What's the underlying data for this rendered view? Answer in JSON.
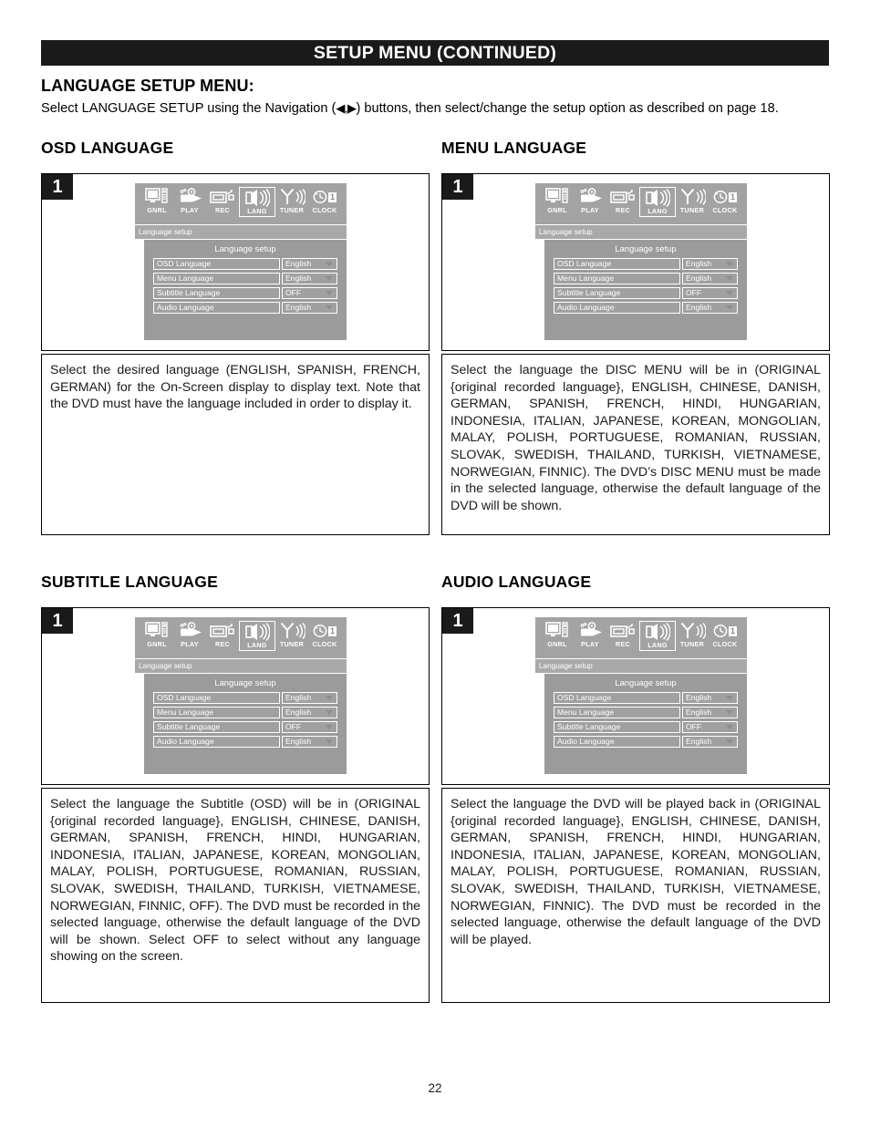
{
  "header": {
    "title": "SETUP MENU (CONTINUED)"
  },
  "intro": {
    "heading": "LANGUAGE SETUP MENU:",
    "body_before": "Select LANGUAGE SETUP using the Navigation (",
    "nav_glyphs": "◀,▶",
    "body_after": ") buttons, then select/change the setup option as described on page 18."
  },
  "sections": {
    "osd": {
      "heading": "OSD LANGUAGE",
      "step": "1",
      "description": "Select the desired language (ENGLISH, SPANISH, FRENCH, GERMAN) for the On-Screen display to display text. Note that the DVD must have the language included in order to display it."
    },
    "menu": {
      "heading": "MENU LANGUAGE",
      "step": "1",
      "description": "Select the language the DISC MENU will be in (ORIGINAL {original recorded language}, ENGLISH, CHINESE, DANISH, GERMAN, SPANISH, FRENCH, HINDI, HUNGARIAN, INDONESIA, ITALIAN, JAPANESE, KOREAN, MONGOLIAN, MALAY, POLISH, PORTUGUESE, ROMANIAN, RUSSIAN, SLOVAK, SWEDISH, THAILAND, TURKISH, VIETNAMESE, NORWEGIAN, FINNIC). The DVD’s DISC MENU must be made in the selected language, otherwise the default language of the DVD will be shown."
    },
    "subtitle": {
      "heading": "SUBTITLE LANGUAGE",
      "step": "1",
      "description": "Select the language the Subtitle (OSD) will be in (ORIGINAL {original recorded language}, ENGLISH, CHINESE, DANISH, GERMAN, SPANISH, FRENCH, HINDI, HUNGARIAN, INDONESIA, ITALIAN, JAPANESE, KOREAN, MONGOLIAN, MALAY, POLISH, PORTUGUESE, ROMANIAN, RUSSIAN, SLOVAK, SWEDISH, THAILAND, TURKISH, VIETNAMESE, NORWEGIAN, FINNIC, OFF). The DVD must be recorded in the selected language, otherwise the default language of the DVD will be shown. Select OFF to select without any language showing on the screen."
    },
    "audio": {
      "heading": "AUDIO LANGUAGE",
      "step": "1",
      "description": "Select the language the DVD will be played back in (ORIGINAL {original recorded language}, ENGLISH, CHINESE, DANISH, GERMAN, SPANISH, FRENCH, HINDI, HUNGARIAN, INDONESIA, ITALIAN, JAPANESE, KOREAN, MONGOLIAN, MALAY, POLISH, PORTUGUESE, ROMANIAN, RUSSIAN, SLOVAK, SWEDISH, THAILAND, TURKISH, VIETNAMESE, NORWEGIAN, FINNIC). The DVD must be recorded in the selected language, otherwise the default language of the DVD will be played."
    }
  },
  "osd_screen": {
    "icons": [
      {
        "label": "GNRL",
        "icon_name": "monitor-icon",
        "selected": false
      },
      {
        "label": "PLAY",
        "icon_name": "projector-icon",
        "selected": false
      },
      {
        "label": "REC",
        "icon_name": "camcorder-icon",
        "selected": false
      },
      {
        "label": "LANG",
        "icon_name": "speaker-icon",
        "selected": true
      },
      {
        "label": "TUNER",
        "icon_name": "antenna-icon",
        "selected": false
      },
      {
        "label": "CLOCK",
        "icon_name": "clock-icon",
        "selected": false
      }
    ],
    "clock_badge": "1",
    "breadcrumb": "Language setup",
    "panel_title": "Language setup",
    "rows": [
      {
        "label": "OSD Language",
        "value": "English"
      },
      {
        "label": "Menu Language",
        "value": "English"
      },
      {
        "label": "Subtitle Language",
        "value": "OFF"
      },
      {
        "label": "Audio Language",
        "value": "English"
      }
    ]
  },
  "footer": {
    "page_number": "22"
  },
  "colors": {
    "header_bar": "#1a1a1a",
    "icon_bar": "#a3a3a3",
    "crumb_bar": "#a9a9a9",
    "panel": "#9b9b9b",
    "field": "#a0a0a0",
    "field_border": "#ffffff",
    "text": "#000000"
  }
}
